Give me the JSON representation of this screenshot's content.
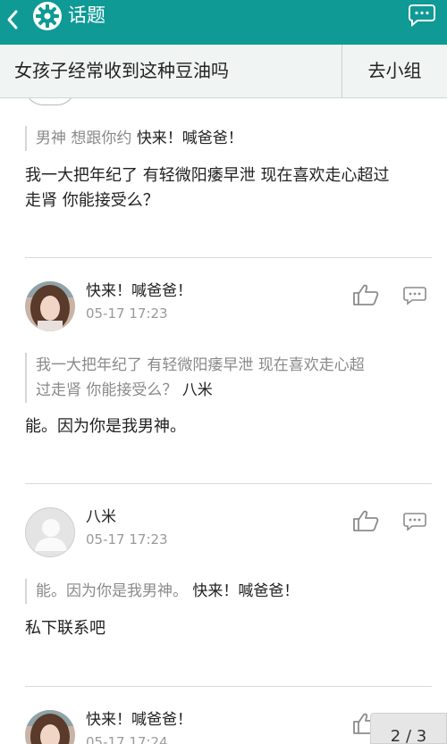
{
  "appbar": {
    "title": "话题",
    "icons": [
      "back-arrow-icon",
      "topic-gear-logo-icon",
      "chat-bubble-icon"
    ]
  },
  "topic": {
    "title": "女孩子经常收到这种豆油吗",
    "group_button": "去小组"
  },
  "replies": [
    {
      "quote_text": "男神 想跟你约",
      "quote_author": "快来！喊爸爸！",
      "body": [
        "我一大把年纪了 有轻微阳痿早泄  现在喜欢走心超过",
        "走肾 你能接受么？"
      ]
    },
    {
      "name": "快来！喊爸爸！",
      "time": "05-17 17:23",
      "quote_lines": [
        "我一大把年纪了 有轻微阳痿早泄  现在喜欢走心超",
        "过走肾 你能接受么？ "
      ],
      "quote_author": "八米",
      "body": "能。因为你是我男神。"
    },
    {
      "name": "八米",
      "time": "05-17 17:23",
      "quote_text": "能。因为你是我男神。",
      "quote_author": "快来！喊爸爸！",
      "body": "私下联系吧"
    },
    {
      "name": "快来！喊爸爸！",
      "time": "05-17 17:24"
    }
  ],
  "pager": "2 / 3",
  "colors": {
    "appbar": "#0f9a95",
    "topic_bar": "#f0f4f2",
    "muted_text": "#8a8a8a"
  }
}
